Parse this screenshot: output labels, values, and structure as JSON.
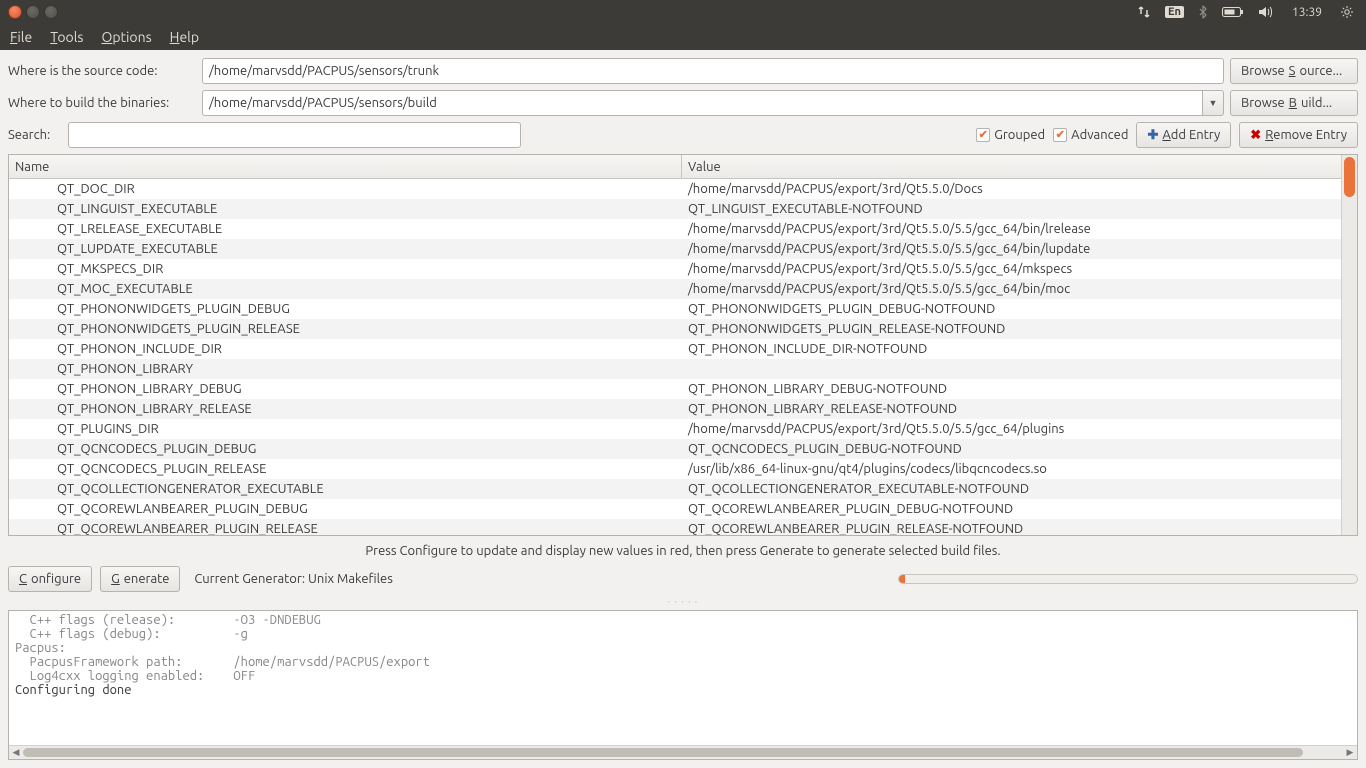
{
  "panel": {
    "lang": "En",
    "time": "13:39"
  },
  "menubar": {
    "file": "File",
    "tools": "Tools",
    "options": "Options",
    "help": "Help"
  },
  "labels": {
    "source": "Where is the source code:",
    "build": "Where to build the binaries:",
    "search": "Search:",
    "browse_source": "Browse Source...",
    "browse_build": "Browse Build...",
    "grouped": "Grouped",
    "advanced": "Advanced",
    "add_entry": "Add Entry",
    "remove_entry": "Remove Entry",
    "name_col": "Name",
    "value_col": "Value",
    "hint": "Press Configure to update and display new values in red, then press Generate to generate selected build files.",
    "configure": "Configure",
    "generate": "Generate",
    "current_generator_prefix": "Current Generator:",
    "current_generator": "Unix Makefiles"
  },
  "paths": {
    "source": "/home/marvsdd/PACPUS/sensors/trunk",
    "build": "/home/marvsdd/PACPUS/sensors/build"
  },
  "table": [
    {
      "name": "QT_DOC_DIR",
      "value": "/home/marvsdd/PACPUS/export/3rd/Qt5.5.0/Docs"
    },
    {
      "name": "QT_LINGUIST_EXECUTABLE",
      "value": "QT_LINGUIST_EXECUTABLE-NOTFOUND"
    },
    {
      "name": "QT_LRELEASE_EXECUTABLE",
      "value": "/home/marvsdd/PACPUS/export/3rd/Qt5.5.0/5.5/gcc_64/bin/lrelease"
    },
    {
      "name": "QT_LUPDATE_EXECUTABLE",
      "value": "/home/marvsdd/PACPUS/export/3rd/Qt5.5.0/5.5/gcc_64/bin/lupdate"
    },
    {
      "name": "QT_MKSPECS_DIR",
      "value": "/home/marvsdd/PACPUS/export/3rd/Qt5.5.0/5.5/gcc_64/mkspecs"
    },
    {
      "name": "QT_MOC_EXECUTABLE",
      "value": "/home/marvsdd/PACPUS/export/3rd/Qt5.5.0/5.5/gcc_64/bin/moc"
    },
    {
      "name": "QT_PHONONWIDGETS_PLUGIN_DEBUG",
      "value": "QT_PHONONWIDGETS_PLUGIN_DEBUG-NOTFOUND"
    },
    {
      "name": "QT_PHONONWIDGETS_PLUGIN_RELEASE",
      "value": "QT_PHONONWIDGETS_PLUGIN_RELEASE-NOTFOUND"
    },
    {
      "name": "QT_PHONON_INCLUDE_DIR",
      "value": "QT_PHONON_INCLUDE_DIR-NOTFOUND"
    },
    {
      "name": "QT_PHONON_LIBRARY",
      "value": ""
    },
    {
      "name": "QT_PHONON_LIBRARY_DEBUG",
      "value": "QT_PHONON_LIBRARY_DEBUG-NOTFOUND"
    },
    {
      "name": "QT_PHONON_LIBRARY_RELEASE",
      "value": "QT_PHONON_LIBRARY_RELEASE-NOTFOUND"
    },
    {
      "name": "QT_PLUGINS_DIR",
      "value": "/home/marvsdd/PACPUS/export/3rd/Qt5.5.0/5.5/gcc_64/plugins"
    },
    {
      "name": "QT_QCNCODECS_PLUGIN_DEBUG",
      "value": "QT_QCNCODECS_PLUGIN_DEBUG-NOTFOUND"
    },
    {
      "name": "QT_QCNCODECS_PLUGIN_RELEASE",
      "value": "/usr/lib/x86_64-linux-gnu/qt4/plugins/codecs/libqcncodecs.so"
    },
    {
      "name": "QT_QCOLLECTIONGENERATOR_EXECUTABLE",
      "value": "QT_QCOLLECTIONGENERATOR_EXECUTABLE-NOTFOUND"
    },
    {
      "name": "QT_QCOREWLANBEARER_PLUGIN_DEBUG",
      "value": "QT_QCOREWLANBEARER_PLUGIN_DEBUG-NOTFOUND"
    },
    {
      "name": "QT_QCOREWLANBEARER_PLUGIN_RELEASE",
      "value": "QT_QCOREWLANBEARER_PLUGIN_RELEASE-NOTFOUND"
    }
  ],
  "console_lines": [
    "  C++ flags (release):        -O3 -DNDEBUG",
    "  C++ flags (debug):          -g",
    "",
    "Pacpus:",
    "  PacpusFramework path:       /home/marvsdd/PACPUS/export",
    "  Log4cxx logging enabled:    OFF",
    "",
    "Configuring done"
  ]
}
